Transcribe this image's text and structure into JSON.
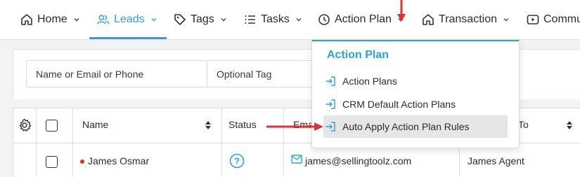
{
  "nav": {
    "items": [
      {
        "label": "Home",
        "icon": "home-icon"
      },
      {
        "label": "Leads",
        "icon": "users-icon",
        "active": true
      },
      {
        "label": "Tags",
        "icon": "tag-icon"
      },
      {
        "label": "Tasks",
        "icon": "list-icon"
      },
      {
        "label": "Action Plan",
        "icon": "clock-icon"
      },
      {
        "label": "Transaction",
        "icon": "home-icon"
      },
      {
        "label": "Commu",
        "icon": "video-icon"
      }
    ]
  },
  "filters": {
    "name_placeholder": "Name or Email or Phone",
    "tag_placeholder": "Optional Tag"
  },
  "table": {
    "headers": {
      "name": "Name",
      "status": "Status",
      "email": "Ema",
      "assigned": "To"
    },
    "rows": [
      {
        "name": "James Osmar",
        "status": "?",
        "email": "james@sellingtoolz.com",
        "agent": "James Agent"
      }
    ]
  },
  "dropdown": {
    "title": "Action Plan",
    "items": [
      {
        "label": "Action Plans"
      },
      {
        "label": "CRM Default Action Plans"
      },
      {
        "label": "Auto Apply Action Plan Rules",
        "highlighted": true
      }
    ]
  },
  "colors": {
    "accent": "#2aa3dc",
    "annotation_arrow": "#e0302f",
    "status_dot": "#d0361f"
  }
}
